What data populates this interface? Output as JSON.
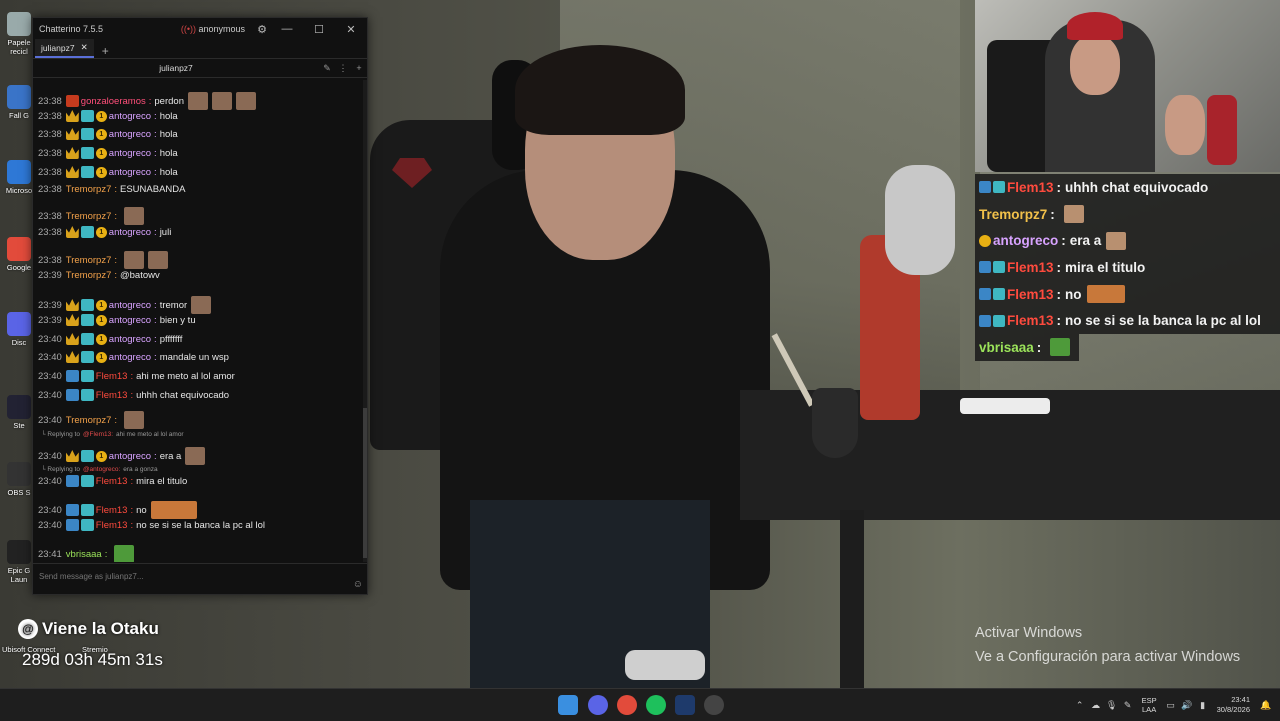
{
  "chatterino": {
    "title": "Chatterino 7.5.5",
    "user": "anonymous",
    "tab_label": "julianpz7",
    "channel_name": "julianpz7",
    "input_placeholder": "Send message as julianpz7...",
    "messages": [
      {
        "ts": "23:38",
        "user": "gonzaloeramos",
        "sep": ":",
        "text": "perdon",
        "color": "#ff4f7a",
        "badges": [
          "red"
        ],
        "emotes": 3
      },
      {
        "ts": "23:38",
        "user": "antogreco",
        "sep": ":",
        "text": "hola",
        "color": "#d8a3ff",
        "badges": [
          "crown",
          "sub",
          "coin"
        ]
      },
      {
        "ts": "23:38",
        "user": "antogreco",
        "sep": ":",
        "text": "hola",
        "color": "#d8a3ff",
        "badges": [
          "crown",
          "sub",
          "coin"
        ]
      },
      {
        "ts": "23:38",
        "user": "antogreco",
        "sep": ":",
        "text": "hola",
        "color": "#d8a3ff",
        "badges": [
          "crown",
          "sub",
          "coin"
        ]
      },
      {
        "ts": "23:38",
        "user": "antogreco",
        "sep": ":",
        "text": "hola",
        "color": "#d8a3ff",
        "badges": [
          "crown",
          "sub",
          "coin"
        ]
      },
      {
        "ts": "23:38",
        "user": "Tremorpz7",
        "sep": ":",
        "text": "ESUNABANDA",
        "color": "#f2a14a",
        "badges": []
      },
      {
        "ts": "23:38",
        "user": "Tremorpz7",
        "sep": ":",
        "text": "",
        "color": "#f2a14a",
        "badges": [],
        "emotes": 1
      },
      {
        "ts": "23:38",
        "user": "antogreco",
        "sep": ":",
        "text": "juli",
        "color": "#d8a3ff",
        "badges": [
          "crown",
          "sub",
          "coin"
        ]
      },
      {
        "ts": "23:38",
        "user": "Tremorpz7",
        "sep": ":",
        "text": "",
        "color": "#f2a14a",
        "badges": [],
        "emotes": 2
      },
      {
        "ts": "23:39",
        "user": "Tremorpz7",
        "sep": ":",
        "text": "@batowv",
        "color": "#f2a14a",
        "badges": []
      },
      {
        "ts": "23:39",
        "user": "antogreco",
        "sep": ":",
        "text": "tremor",
        "color": "#d8a3ff",
        "badges": [
          "crown",
          "sub",
          "coin"
        ],
        "emotes": 1
      },
      {
        "ts": "23:39",
        "user": "antogreco",
        "sep": ":",
        "text": "bien y tu",
        "color": "#d8a3ff",
        "badges": [
          "crown",
          "sub",
          "coin"
        ]
      },
      {
        "ts": "23:40",
        "user": "antogreco",
        "sep": ":",
        "text": "pfffffff",
        "color": "#d8a3ff",
        "badges": [
          "crown",
          "sub",
          "coin"
        ]
      },
      {
        "ts": "23:40",
        "user": "antogreco",
        "sep": ":",
        "text": "mandale un wsp",
        "color": "#d8a3ff",
        "badges": [
          "crown",
          "sub",
          "coin"
        ]
      },
      {
        "ts": "23:40",
        "user": "Flem13",
        "sep": ":",
        "text": "ahi me meto al lol amor",
        "color": "#ff4b3e",
        "badges": [
          "prime",
          "sub"
        ]
      },
      {
        "ts": "23:40",
        "user": "Flem13",
        "sep": ":",
        "text": "uhhh chat equivocado",
        "color": "#ff4b3e",
        "badges": [
          "prime",
          "sub"
        ]
      },
      {
        "ts": "23:40",
        "user": "Tremorpz7",
        "sep": ":",
        "text": "",
        "color": "#f2a14a",
        "badges": [],
        "emotes": 1
      },
      {
        "ts": "23:40",
        "user": "antogreco",
        "sep": ":",
        "text": "era a",
        "color": "#d8a3ff",
        "badges": [
          "crown",
          "sub",
          "coin"
        ],
        "emotes": 1
      },
      {
        "ts": "23:40",
        "user": "Flem13",
        "sep": ":",
        "text": "mira el titulo",
        "color": "#ff4b3e",
        "badges": [
          "prime",
          "sub"
        ]
      },
      {
        "ts": "23:40",
        "user": "Flem13",
        "sep": ":",
        "text": "no",
        "color": "#ff4b3e",
        "badges": [
          "prime",
          "sub"
        ],
        "emotes": 1
      },
      {
        "ts": "23:40",
        "user": "Flem13",
        "sep": ":",
        "text": "no se si se la banca la pc al lol",
        "color": "#ff4b3e",
        "badges": [
          "prime",
          "sub"
        ]
      },
      {
        "ts": "23:41",
        "user": "vbrisaaa",
        "sep": ":",
        "text": "",
        "color": "#9be35a",
        "badges": [],
        "emotes": 1
      }
    ],
    "replies": [
      {
        "prefix": "Replying to",
        "name": "@Flem13:",
        "text": "ahi me meto al lol amor"
      },
      {
        "prefix": "Replying to",
        "name": "@antogreco:",
        "text": "era a gonza"
      }
    ]
  },
  "overlay_chat": [
    {
      "user": "Flem13",
      "sep": " :",
      "text": "uhhh chat equivocado",
      "color": "#ff4b3e",
      "badges": [
        "prime",
        "sub"
      ]
    },
    {
      "user": "Tremorpz7",
      "sep": " :",
      "text": "",
      "color": "#f2c14a",
      "badges": [],
      "emote": true
    },
    {
      "user": "antogreco",
      "sep": " :",
      "text": "era a",
      "color": "#d8a3ff",
      "badges": [
        "coin"
      ],
      "emote": true
    },
    {
      "user": "Flem13",
      "sep": " :",
      "text": "mira el titulo",
      "color": "#ff4b3e",
      "badges": [
        "prime",
        "sub"
      ]
    },
    {
      "user": "Flem13",
      "sep": " :",
      "text": "no",
      "color": "#ff4b3e",
      "badges": [
        "prime",
        "sub"
      ],
      "emote": true
    },
    {
      "user": "Flem13",
      "sep": " :",
      "text": "no se si se la banca la pc al lol",
      "color": "#ff4b3e",
      "badges": [
        "prime",
        "sub"
      ]
    },
    {
      "user": "vbrisaaa",
      "sep": " :",
      "text": "",
      "color": "#9be35a",
      "badges": [],
      "emote": true
    }
  ],
  "desktop_icons": [
    "Papele recicl",
    "Fall G",
    "Microso",
    "Google",
    "Disc",
    "Ste",
    "OBS S",
    "Epic G Laun"
  ],
  "bottom_labels": {
    "ubisoft": "Ubisoft Connect",
    "stremio": "Stremio"
  },
  "viene": "Viene la Otaku",
  "timer": "289d 03h 45m 31s",
  "activate": {
    "line1": "Activar Windows",
    "line2": "Ve a Configuración para activar Windows"
  },
  "tray": {
    "lang1": "ESP",
    "lang2": "LAA",
    "time": "23:41",
    "date": "30/8/2026"
  },
  "colors": {
    "accent": "#5a6fd8",
    "chat_bg": "#111111",
    "taskbar": "#1e1e1e"
  }
}
